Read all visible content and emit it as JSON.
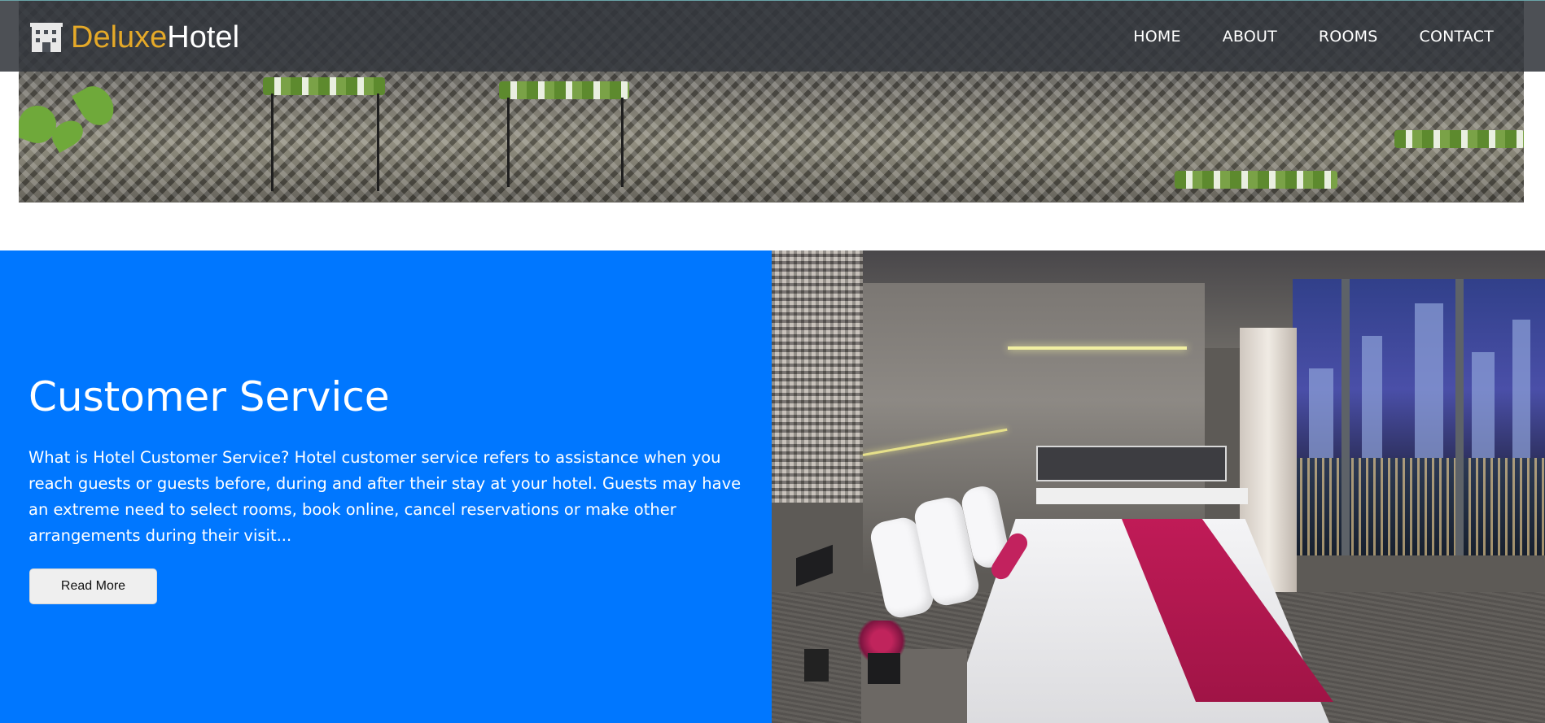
{
  "brand": {
    "part1": "Deluxe",
    "part2": "Hotel",
    "icon": "building-icon"
  },
  "nav": {
    "items": [
      {
        "label": "HOME"
      },
      {
        "label": "ABOUT"
      },
      {
        "label": "ROOMS"
      },
      {
        "label": "CONTACT"
      }
    ]
  },
  "feature": {
    "title": "Customer Service",
    "body": "What is Hotel Customer Service? Hotel customer service refers to assistance when you reach guests or guests before, during and after their stay at your hotel. Guests may have an extreme need to select rooms, book online, cancel reservations or make other arrangements during their visit...",
    "button_label": "Read More"
  },
  "colors": {
    "accent": "#e5a928",
    "panel_blue": "#0077ff",
    "navbar": "#34383e"
  }
}
